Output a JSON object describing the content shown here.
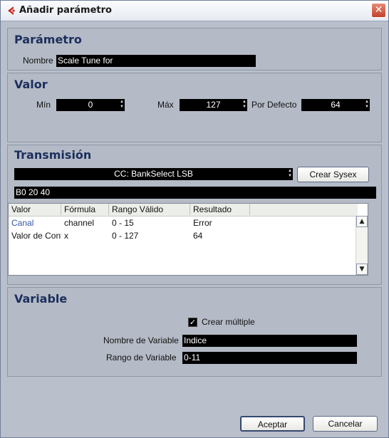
{
  "window": {
    "title": "Añadir parámetro",
    "close_glyph": "✕"
  },
  "parametro": {
    "heading": "Parámetro",
    "nombre_label": "Nombre",
    "nombre_value": "Scale Tune for"
  },
  "valor": {
    "heading": "Valor",
    "min_label": "Mín",
    "min_value": "0",
    "max_label": "Máx",
    "max_value": "127",
    "defecto_label": "Por Defecto",
    "defecto_value": "64"
  },
  "transmision": {
    "heading": "Transmisión",
    "cc_select": "CC: BankSelect LSB",
    "crear_sysex": "Crear Sysex",
    "hex_value": "B0 20 40",
    "table": {
      "headers": [
        "Valor",
        "Fórmula",
        "Rango Válido",
        "Resultado"
      ],
      "rows": [
        {
          "valor": "Canal",
          "formula": "channel",
          "rango": "0 - 15",
          "resultado": "Error"
        },
        {
          "valor": "Valor de Cont",
          "formula": "x",
          "rango": "0 - 127",
          "resultado": "64"
        }
      ]
    }
  },
  "variable": {
    "heading": "Variable",
    "crear_multiple": "Crear múltiple",
    "crear_multiple_checked": true,
    "nombre_label": "Nombre de Variable",
    "nombre_value": "Indice",
    "rango_label": "Rango de Variable",
    "rango_value": "0-11"
  },
  "buttons": {
    "aceptar": "Aceptar",
    "cancelar": "Cancelar"
  },
  "colors": {
    "accent": "#1c2e5c",
    "field_bg": "#000000",
    "panel_bg": "#b4bac6",
    "selected_text": "#3557a8"
  }
}
